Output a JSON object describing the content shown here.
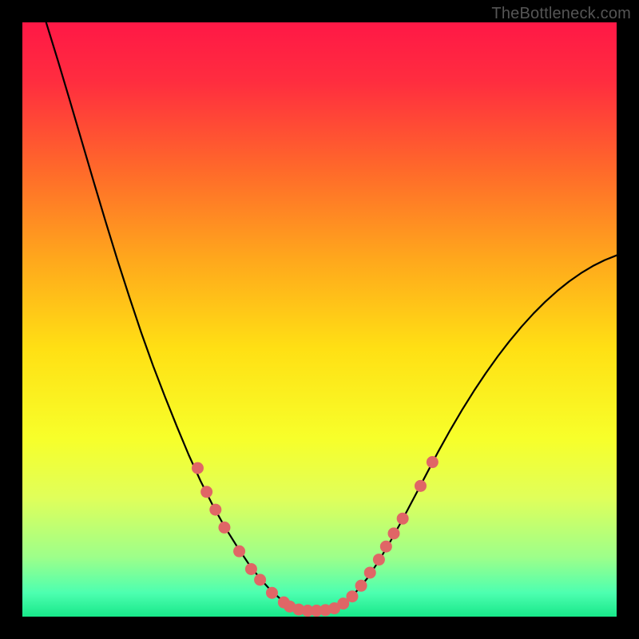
{
  "watermark": "TheBottleneck.com",
  "chart_data": {
    "type": "line",
    "title": "",
    "xlabel": "",
    "ylabel": "",
    "xlim": [
      0,
      100
    ],
    "ylim": [
      0,
      100
    ],
    "gradient_stops": [
      {
        "offset": 0.0,
        "color": "#ff1846"
      },
      {
        "offset": 0.1,
        "color": "#ff2d3f"
      },
      {
        "offset": 0.25,
        "color": "#ff6a2a"
      },
      {
        "offset": 0.4,
        "color": "#ffa81c"
      },
      {
        "offset": 0.55,
        "color": "#ffe014"
      },
      {
        "offset": 0.7,
        "color": "#f7ff2a"
      },
      {
        "offset": 0.8,
        "color": "#e0ff5a"
      },
      {
        "offset": 0.9,
        "color": "#9dff8a"
      },
      {
        "offset": 0.96,
        "color": "#4dffb0"
      },
      {
        "offset": 1.0,
        "color": "#18e88a"
      }
    ],
    "series": [
      {
        "name": "bottleneck-curve",
        "stroke": "#000000",
        "stroke_width": 2.2,
        "points": [
          {
            "x": 4.0,
            "y": 100.0
          },
          {
            "x": 6.0,
            "y": 93.5
          },
          {
            "x": 8.0,
            "y": 86.8
          },
          {
            "x": 10.0,
            "y": 80.0
          },
          {
            "x": 12.0,
            "y": 73.2
          },
          {
            "x": 14.0,
            "y": 66.5
          },
          {
            "x": 16.0,
            "y": 60.0
          },
          {
            "x": 18.0,
            "y": 53.8
          },
          {
            "x": 20.0,
            "y": 47.8
          },
          {
            "x": 22.0,
            "y": 42.2
          },
          {
            "x": 24.0,
            "y": 37.0
          },
          {
            "x": 26.0,
            "y": 32.0
          },
          {
            "x": 28.0,
            "y": 27.2
          },
          {
            "x": 30.0,
            "y": 22.8
          },
          {
            "x": 32.0,
            "y": 18.8
          },
          {
            "x": 34.0,
            "y": 15.2
          },
          {
            "x": 36.0,
            "y": 12.0
          },
          {
            "x": 38.0,
            "y": 9.0
          },
          {
            "x": 40.0,
            "y": 6.4
          },
          {
            "x": 42.0,
            "y": 4.2
          },
          {
            "x": 44.0,
            "y": 2.5
          },
          {
            "x": 46.0,
            "y": 1.4
          },
          {
            "x": 48.0,
            "y": 1.0
          },
          {
            "x": 50.0,
            "y": 1.0
          },
          {
            "x": 52.0,
            "y": 1.2
          },
          {
            "x": 54.0,
            "y": 2.2
          },
          {
            "x": 56.0,
            "y": 4.0
          },
          {
            "x": 58.0,
            "y": 6.4
          },
          {
            "x": 60.0,
            "y": 9.4
          },
          {
            "x": 62.0,
            "y": 12.8
          },
          {
            "x": 64.0,
            "y": 16.4
          },
          {
            "x": 66.0,
            "y": 20.2
          },
          {
            "x": 68.0,
            "y": 24.0
          },
          {
            "x": 70.0,
            "y": 27.8
          },
          {
            "x": 72.0,
            "y": 31.4
          },
          {
            "x": 74.0,
            "y": 34.8
          },
          {
            "x": 76.0,
            "y": 38.0
          },
          {
            "x": 78.0,
            "y": 41.0
          },
          {
            "x": 80.0,
            "y": 43.8
          },
          {
            "x": 82.0,
            "y": 46.4
          },
          {
            "x": 84.0,
            "y": 48.8
          },
          {
            "x": 86.0,
            "y": 51.0
          },
          {
            "x": 88.0,
            "y": 53.0
          },
          {
            "x": 90.0,
            "y": 54.8
          },
          {
            "x": 92.0,
            "y": 56.4
          },
          {
            "x": 94.0,
            "y": 57.8
          },
          {
            "x": 96.0,
            "y": 59.0
          },
          {
            "x": 98.0,
            "y": 60.0
          },
          {
            "x": 100.0,
            "y": 60.8
          }
        ]
      }
    ],
    "markers": {
      "fill": "#e06666",
      "radius": 7.5,
      "points": [
        {
          "x": 29.5,
          "y": 25.0
        },
        {
          "x": 31.0,
          "y": 21.0
        },
        {
          "x": 32.5,
          "y": 18.0
        },
        {
          "x": 34.0,
          "y": 15.0
        },
        {
          "x": 36.5,
          "y": 11.0
        },
        {
          "x": 38.5,
          "y": 8.0
        },
        {
          "x": 40.0,
          "y": 6.2
        },
        {
          "x": 42.0,
          "y": 4.0
        },
        {
          "x": 44.0,
          "y": 2.4
        },
        {
          "x": 45.0,
          "y": 1.7
        },
        {
          "x": 46.5,
          "y": 1.2
        },
        {
          "x": 48.0,
          "y": 1.0
        },
        {
          "x": 49.5,
          "y": 1.0
        },
        {
          "x": 51.0,
          "y": 1.1
        },
        {
          "x": 52.5,
          "y": 1.4
        },
        {
          "x": 54.0,
          "y": 2.2
        },
        {
          "x": 55.5,
          "y": 3.4
        },
        {
          "x": 57.0,
          "y": 5.2
        },
        {
          "x": 58.5,
          "y": 7.4
        },
        {
          "x": 60.0,
          "y": 9.6
        },
        {
          "x": 61.2,
          "y": 11.8
        },
        {
          "x": 62.5,
          "y": 14.0
        },
        {
          "x": 64.0,
          "y": 16.5
        },
        {
          "x": 67.0,
          "y": 22.0
        },
        {
          "x": 69.0,
          "y": 26.0
        }
      ]
    }
  }
}
